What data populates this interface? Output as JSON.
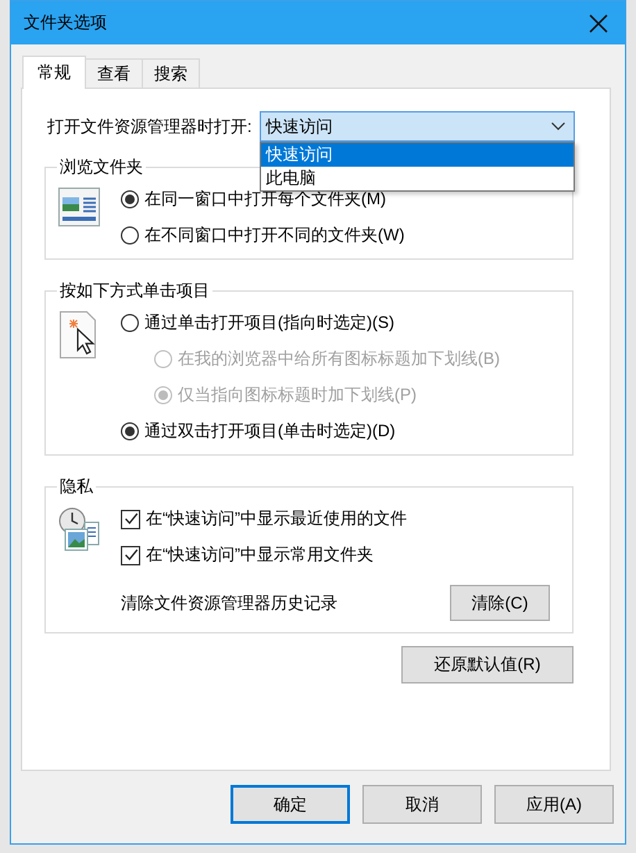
{
  "window": {
    "title": "文件夹选项"
  },
  "tabs": [
    {
      "label": "常规",
      "selected": true
    },
    {
      "label": "查看",
      "selected": false
    },
    {
      "label": "搜索",
      "selected": false
    }
  ],
  "open_explorer": {
    "label": "打开文件资源管理器时打开:",
    "value": "快速访问",
    "expanded": true,
    "options": [
      {
        "label": "快速访问",
        "selected": true
      },
      {
        "label": "此电脑",
        "selected": false
      }
    ]
  },
  "groups": [
    {
      "title": "浏览文件夹",
      "items": [
        {
          "kind": "radio",
          "label": "在同一窗口中打开每个文件夹(M)",
          "checked": true,
          "disabled": false
        },
        {
          "kind": "radio",
          "label": "在不同窗口中打开不同的文件夹(W)",
          "checked": false,
          "disabled": false
        }
      ]
    },
    {
      "title": "按如下方式单击项目",
      "items": [
        {
          "kind": "radio",
          "label": "通过单击打开项目(指向时选定)(S)",
          "checked": false,
          "disabled": false,
          "children": [
            {
              "kind": "radio",
              "label": "在我的浏览器中给所有图标标题加下划线(B)",
              "checked": false,
              "disabled": true
            },
            {
              "kind": "radio",
              "label": "仅当指向图标标题时加下划线(P)",
              "checked": true,
              "disabled": true
            }
          ]
        },
        {
          "kind": "radio",
          "label": "通过双击打开项目(单击时选定)(D)",
          "checked": true,
          "disabled": false
        }
      ]
    },
    {
      "title": "隐私",
      "items": [
        {
          "kind": "checkbox",
          "label": "在“快速访问”中显示最近使用的文件",
          "checked": true,
          "disabled": false
        },
        {
          "kind": "checkbox",
          "label": "在“快速访问”中显示常用文件夹",
          "checked": true,
          "disabled": false
        },
        {
          "kind": "action",
          "label": "清除文件资源管理器历史记录",
          "button": "清除(C)"
        }
      ]
    }
  ],
  "restore_button": "还原默认值(R)",
  "buttons": [
    {
      "label": "确定",
      "default": true
    },
    {
      "label": "取消",
      "default": false
    },
    {
      "label": "应用(A)",
      "default": false
    }
  ]
}
